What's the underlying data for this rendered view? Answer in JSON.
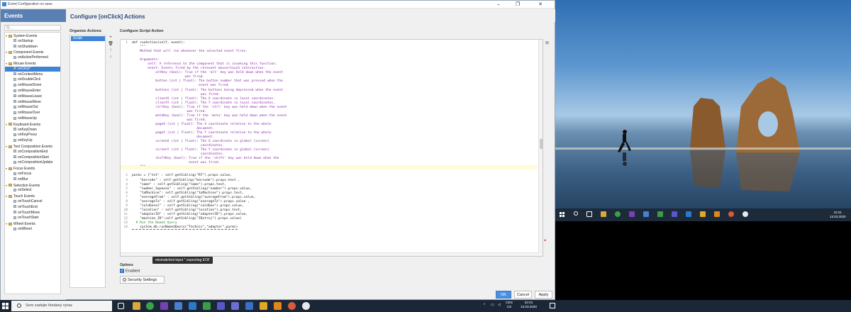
{
  "window": {
    "title": "Event Configuration on save"
  },
  "events_panel": {
    "header": "Events",
    "search_placeholder": "Q...",
    "tree": [
      {
        "label": "System Events",
        "level": 0,
        "folder": true
      },
      {
        "label": "onStartup",
        "level": 1
      },
      {
        "label": "onShutdown",
        "level": 1
      },
      {
        "label": "Component Events",
        "level": 0,
        "folder": true
      },
      {
        "label": "onActionPerformed",
        "level": 1
      },
      {
        "label": "Mouse Events",
        "level": 0,
        "folder": true
      },
      {
        "label": "onClick*",
        "level": 1,
        "selected": true
      },
      {
        "label": "onContextMenu",
        "level": 1
      },
      {
        "label": "onDoubleClick",
        "level": 1
      },
      {
        "label": "onMouseDown",
        "level": 1
      },
      {
        "label": "onMouseEnter",
        "level": 1
      },
      {
        "label": "onMouseLeave",
        "level": 1
      },
      {
        "label": "onMouseMove",
        "level": 1
      },
      {
        "label": "onMouseOut",
        "level": 1
      },
      {
        "label": "onMouseOver",
        "level": 1
      },
      {
        "label": "onMouseUp",
        "level": 1
      },
      {
        "label": "Keyboard Events",
        "level": 0,
        "folder": true
      },
      {
        "label": "onKeyDown",
        "level": 1
      },
      {
        "label": "onKeyPress",
        "level": 1
      },
      {
        "label": "onKeyUp",
        "level": 1
      },
      {
        "label": "Text Composition Events",
        "level": 0,
        "folder": true
      },
      {
        "label": "onCompositionEnd",
        "level": 1
      },
      {
        "label": "onCompositionStart",
        "level": 1
      },
      {
        "label": "onCompositionUpdate",
        "level": 1
      },
      {
        "label": "Focus Events",
        "level": 0,
        "folder": true
      },
      {
        "label": "onFocus",
        "level": 1
      },
      {
        "label": "onBlur",
        "level": 1
      },
      {
        "label": "Selection Events",
        "level": 0,
        "folder": true
      },
      {
        "label": "onSelect",
        "level": 1
      },
      {
        "label": "Touch Events",
        "level": 0,
        "folder": true
      },
      {
        "label": "onTouchCancel",
        "level": 1
      },
      {
        "label": "onTouchEnd",
        "level": 1
      },
      {
        "label": "onTouchMove",
        "level": 1
      },
      {
        "label": "onTouchStart",
        "level": 1
      },
      {
        "label": "Wheel Events",
        "level": 0,
        "folder": true
      },
      {
        "label": "onWheel",
        "level": 1
      }
    ]
  },
  "main": {
    "title": "Configure [onClick] Actions",
    "organize_label": "Organize Actions",
    "actions": [
      "Script"
    ],
    "side_buttons": [
      "+",
      "🗑",
      "↑",
      "↓"
    ],
    "config_label": "Configure Script Action",
    "code_lines": [
      {
        "n": "1",
        "t": "def runAction(self, event):"
      },
      {
        "n": "",
        "t": "    \"\"\"",
        "doc": true
      },
      {
        "n": "",
        "t": "    Method that will run whenever the selected event fires.",
        "doc": true
      },
      {
        "n": "",
        "t": "",
        "doc": true
      },
      {
        "n": "",
        "t": "    Arguments:",
        "doc": true
      },
      {
        "n": "",
        "t": "        self: A reference to the component that is invoking this function.",
        "doc": true
      },
      {
        "n": "",
        "t": "        event: Events fired by the relevant mouse/touch interaction.",
        "doc": true
      },
      {
        "n": "",
        "t": "            altKey (bool): True if the 'alt' key was held down when the event",
        "doc": true
      },
      {
        "n": "",
        "t": "                           was fired.",
        "doc": true
      },
      {
        "n": "",
        "t": "            button (int | float): The button number that was pressed when the",
        "doc": true
      },
      {
        "n": "",
        "t": "                                  event was fired.",
        "doc": true
      },
      {
        "n": "",
        "t": "            buttons (int | float): The buttons being depressed when the event",
        "doc": true
      },
      {
        "n": "",
        "t": "                                   was fired.",
        "doc": true
      },
      {
        "n": "",
        "t": "            clientX (int | float): The X coordinate in local coordinates.",
        "doc": true
      },
      {
        "n": "",
        "t": "            clientY (int | float): The Y coordinate in local coordinates.",
        "doc": true
      },
      {
        "n": "",
        "t": "            ctrlKey (bool): True if the 'ctrl' key was held down when the event",
        "doc": true
      },
      {
        "n": "",
        "t": "                            was fired.",
        "doc": true
      },
      {
        "n": "",
        "t": "            metaKey (bool): True if the 'meta' key was held down when the event",
        "doc": true
      },
      {
        "n": "",
        "t": "                            was fired.",
        "doc": true
      },
      {
        "n": "",
        "t": "            pageX (int | float): The X coordinate relative to the whole",
        "doc": true
      },
      {
        "n": "",
        "t": "                                 document.",
        "doc": true
      },
      {
        "n": "",
        "t": "            pageY (int | float): The Y coordinate relative to the whole",
        "doc": true
      },
      {
        "n": "",
        "t": "                                 document.",
        "doc": true
      },
      {
        "n": "",
        "t": "            screenX (int | float): The X coordinate in global (screen)",
        "doc": true
      },
      {
        "n": "",
        "t": "                                   coordinates.",
        "doc": true
      },
      {
        "n": "",
        "t": "            screenY (int | float): The Y coordinate in global (screen)",
        "doc": true
      },
      {
        "n": "",
        "t": "                                   coordinates.",
        "doc": true
      },
      {
        "n": "",
        "t": "            shiftKey (bool): True if the 'shift' key was held down when the",
        "doc": true
      },
      {
        "n": "",
        "t": "                             event was fired.",
        "doc": true
      },
      {
        "n": "",
        "t": "    \"\"\"",
        "doc": true,
        "hl": true
      },
      {
        "n": "",
        "t": ""
      },
      {
        "n": "2",
        "t": "parms = {\"tet\" : self.getSibling(\"RT\").props.value,"
      },
      {
        "n": "3",
        "t": "    \"barcode\" : self.getSibling(\"barcode\").props.text ,"
      },
      {
        "n": "4",
        "t": "    \"name\" : self.getSibling(\"name\").props.text,"
      },
      {
        "n": "5",
        "t": "    \"number_Squeeze\" : self.getSibling(\"number\").props.value,"
      },
      {
        "n": "6",
        "t": "    \"toMachine\": self.getSibling(\"toMachine\").props.text,"
      },
      {
        "n": "7",
        "t": "    \"averageFrom\" : self.getSibling(\"averageFrom\").props.value,"
      },
      {
        "n": "8",
        "t": "    \"averageTo\" : self.getSibling(\"averageTo\").props.value ,"
      },
      {
        "n": "9",
        "t": "    \"coldGenal\" : self.getSibling(\"coldGen\").props.value,"
      },
      {
        "n": "10",
        "t": "    \"location\" : self.getSibling(\"location\").props.text,"
      },
      {
        "n": "11",
        "t": "    \"adapterID\" : self.getSibling(\"adapterID\").props.value,"
      },
      {
        "n": "12",
        "t": "    \"machine_ID\":self.getSibling(\"IDstroj\").props.value)"
      },
      {
        "n": "13",
        "t": "  # Run the Named Query",
        "cmt": true
      },
      {
        "n": "14",
        "t": "    system.db.runNamedQuery(\"Technic\",\"adapter\",parms)",
        "err": true
      }
    ],
    "tooltip": "mismatched input '' expecting EOF",
    "options_label": "Options",
    "enabled_label": "Enabled",
    "security_button": "Security Settings",
    "ok": "OK",
    "cancel": "Cancel",
    "apply": "Apply"
  },
  "desktop_clock": {
    "time": "22:01",
    "date": "13.03.2020"
  },
  "taskbar": {
    "search_placeholder": "Sem zadejte hledaný výraz",
    "lang": "CES",
    "lang2": "CS",
    "time": "22:01",
    "date": "13.03.2020"
  }
}
